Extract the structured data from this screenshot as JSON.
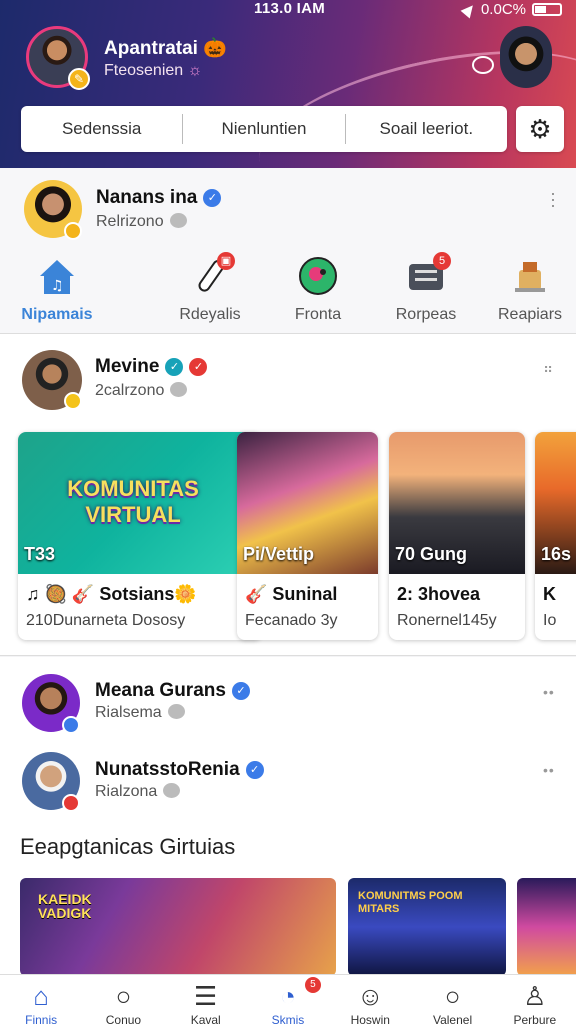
{
  "status": {
    "time": "113.0 IAM",
    "battery": "0.0C%"
  },
  "header": {
    "user_name": "Apantratai",
    "user_emoji": "🎃",
    "user_subtitle": "Fteosenien",
    "segments": [
      "Sedenssia",
      "Nienluntien",
      "Soail leeriot."
    ]
  },
  "profile1": {
    "name": "Nanans ina",
    "subtitle": "Relrizono"
  },
  "categories": [
    {
      "label": "Nipamais",
      "icon": "home-music-icon",
      "active": true
    },
    {
      "label": "Rdeyalis",
      "icon": "microphone-icon",
      "badge": ""
    },
    {
      "label": "Fronta",
      "icon": "globe-icon"
    },
    {
      "label": "Rorpeas",
      "icon": "inbox-icon",
      "badge": "5"
    },
    {
      "label": "Reapiars",
      "icon": "drink-icon"
    }
  ],
  "profile2": {
    "name": "Mevine",
    "subtitle": "2calrzono"
  },
  "cards": [
    {
      "image_text": "KOMUNITAS VIRTUAL",
      "overlay": "T33",
      "title": "♫ 🥘 🎸 Sotsians🌼",
      "subtitle": "210Dunarneta Dososy"
    },
    {
      "overlay": "Pi/Vettip",
      "title": "🎸 Suninal",
      "subtitle": "Fecanado 3y"
    },
    {
      "overlay": "70 Gung",
      "title": "2: 3hovea",
      "subtitle": "Ronernel145y"
    },
    {
      "overlay": "16s",
      "title": "K",
      "subtitle": "Io"
    }
  ],
  "profile3": {
    "name": "Meana Gurans",
    "subtitle": "Rialsema"
  },
  "profile4": {
    "name": "NunatsstoRenia",
    "subtitle": "Rialzona"
  },
  "section_heading": "Eeapgtanicas Girtuias",
  "photos": [
    {
      "text": "KAEIDK VADIGK"
    },
    {
      "text": "KOMUNITMS POOM MITARS"
    },
    {
      "text": ""
    }
  ],
  "bottom_nav": [
    {
      "label": "Finnis",
      "icon": "home-icon",
      "active": true
    },
    {
      "label": "Conuo",
      "icon": "search-icon"
    },
    {
      "label": "Kaval",
      "icon": "list-icon"
    },
    {
      "label": "Skmis",
      "icon": "refresh-icon",
      "badge": "5",
      "active": true
    },
    {
      "label": "Hoswin",
      "icon": "smile-icon"
    },
    {
      "label": "Valenel",
      "icon": "search-icon"
    },
    {
      "label": "Perbure",
      "icon": "person-icon"
    }
  ],
  "colors": {
    "accent": "#3b84d8",
    "badge": "#e53935",
    "verified": "#3b7be8"
  }
}
